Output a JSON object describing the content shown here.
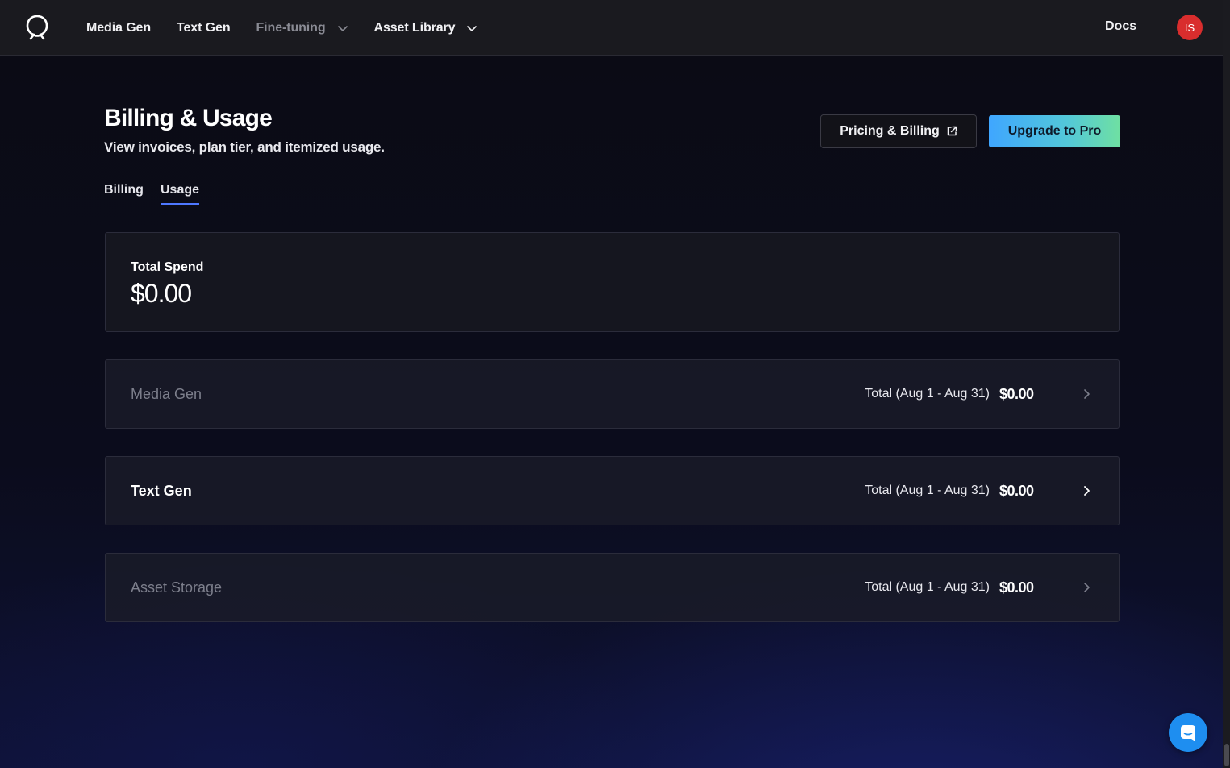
{
  "nav": {
    "items": [
      {
        "label": "Media Gen",
        "muted": false,
        "dropdown": false
      },
      {
        "label": "Text Gen",
        "muted": false,
        "dropdown": false
      },
      {
        "label": "Fine-tuning",
        "muted": true,
        "dropdown": true
      },
      {
        "label": "Asset Library",
        "muted": false,
        "dropdown": true
      }
    ],
    "docs_label": "Docs",
    "avatar_initials": "IS",
    "avatar_color": "#d92d2d"
  },
  "header": {
    "title": "Billing & Usage",
    "subtitle": "View invoices, plan tier, and itemized usage.",
    "pricing_button": "Pricing & Billing",
    "upgrade_button": "Upgrade to Pro"
  },
  "tabs": [
    {
      "label": "Billing",
      "active": false
    },
    {
      "label": "Usage",
      "active": true
    }
  ],
  "total_spend": {
    "label": "Total Spend",
    "value": "$0.00"
  },
  "usage_rows": [
    {
      "name": "Media Gen",
      "total_label": "Total (Aug 1 - Aug 31)",
      "amount": "$0.00",
      "enabled": false
    },
    {
      "name": "Text Gen",
      "total_label": "Total (Aug 1 - Aug 31)",
      "amount": "$0.00",
      "enabled": true
    },
    {
      "name": "Asset Storage",
      "total_label": "Total (Aug 1 - Aug 31)",
      "amount": "$0.00",
      "enabled": false
    }
  ],
  "colors": {
    "accent": "#4e78ff",
    "upgrade_gradient_start": "#3fa6ff",
    "upgrade_gradient_end": "#6fe0a2",
    "chat_button": "#1e8ef0"
  },
  "icons": {
    "logo": "brand-logo-icon",
    "dropdown": "chevron-down-icon",
    "external": "external-link-icon",
    "row": "chevron-right-icon",
    "chat": "chat-icon"
  }
}
